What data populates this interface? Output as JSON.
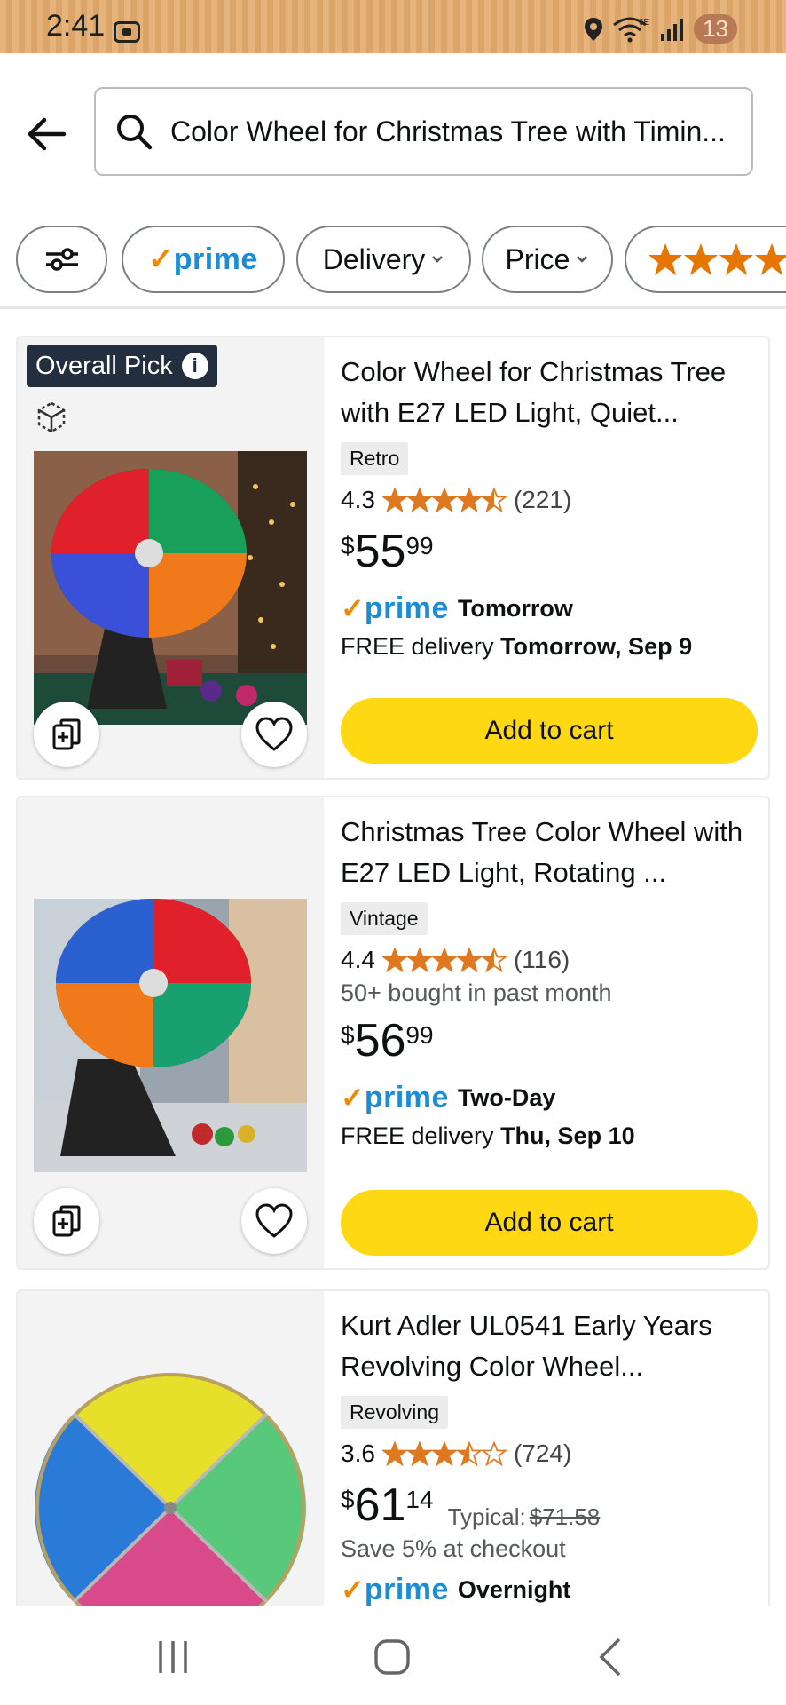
{
  "status_bar": {
    "time": "2:41",
    "battery": "13",
    "network": "6E"
  },
  "search": {
    "query": "Color Wheel for Christmas Tree with Timin..."
  },
  "filters": {
    "prime": "prime",
    "delivery": "Delivery",
    "price": "Price"
  },
  "products": [
    {
      "tag": "Overall Pick",
      "title": "Color Wheel for Christmas Tree with E27 LED Light, Quiet...",
      "badge": "Retro",
      "rating": "4.3",
      "stars": 4.3,
      "reviews": "(221)",
      "price_symbol": "$",
      "price_whole": "55",
      "price_fraction": "99",
      "prime_label": "prime",
      "prime_day": "Tomorrow",
      "free_delivery": "FREE delivery",
      "delivery_date": "Tomorrow, Sep 9",
      "add_to_cart": "Add to cart",
      "image_colors": [
        "#e0202a",
        "#18a05a",
        "#f07a1a",
        "#3a50d8"
      ]
    },
    {
      "title": "Christmas Tree Color Wheel with E27 LED Light, Rotating ...",
      "badge": "Vintage",
      "rating": "4.4",
      "stars": 4.4,
      "reviews": "(116)",
      "bought": "50+ bought in past month",
      "price_symbol": "$",
      "price_whole": "56",
      "price_fraction": "99",
      "prime_label": "prime",
      "prime_day": "Two-Day",
      "free_delivery": "FREE delivery",
      "delivery_date": "Thu, Sep 10",
      "add_to_cart": "Add to cart",
      "image_colors": [
        "#e0202a",
        "#18a070",
        "#f07a1a",
        "#2a60d0"
      ]
    },
    {
      "title": "Kurt Adler UL0541 Early Years Revolving Color Wheel...",
      "badge": "Revolving",
      "rating": "3.6",
      "stars": 3.6,
      "reviews": "(724)",
      "price_symbol": "$",
      "price_whole": "61",
      "price_fraction": "14",
      "typical_label": "Typical:",
      "typical_price": "$71.58",
      "save_text": "Save 5% at checkout",
      "prime_label": "prime",
      "prime_day": "Overnight",
      "image_colors": [
        "#e6e02a",
        "#58c87a",
        "#d84a8a",
        "#2a7ad8"
      ]
    }
  ]
}
